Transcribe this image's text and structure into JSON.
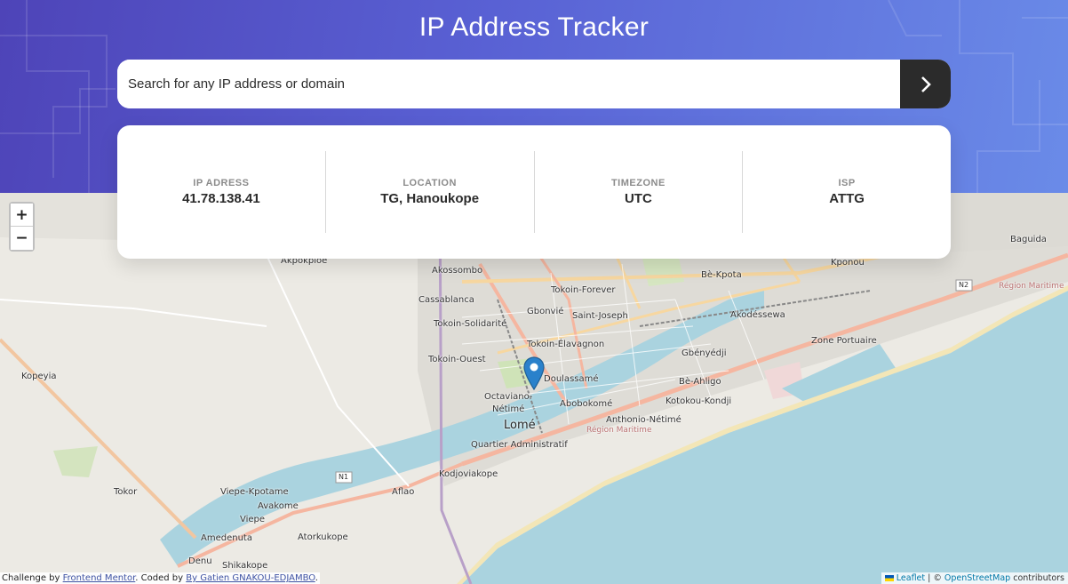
{
  "header": {
    "title": "IP Address Tracker",
    "gradient": [
      "#4e44b8",
      "#6a8be8"
    ]
  },
  "search": {
    "placeholder": "Search for any IP address or domain",
    "button_icon": "chevron-right-icon"
  },
  "info": {
    "ip": {
      "label": "IP ADRESS",
      "value": "41.78.138.41"
    },
    "location": {
      "label": "LOCATION",
      "value": "TG, Hanoukope"
    },
    "timezone": {
      "label": "TIMEZONE",
      "value": "UTC"
    },
    "isp": {
      "label": "ISP",
      "value": "ATTG"
    }
  },
  "map": {
    "zoom_in": "+",
    "zoom_out": "−",
    "marker_color": "#2a81cb",
    "water_color": "#aad3df",
    "labels": {
      "akodessewa": "Akodéssewa",
      "baguida": "Baguida",
      "kponou": "Kponou",
      "akokplo": "Akpokploe",
      "akossombo": "Akossombo",
      "tokoin_forever": "Tokoin-Forever",
      "be_kpota": "Bè-Kpota",
      "cassablanca": "Cassablanca",
      "gbonvie": "Gbonvié",
      "saint_joseph": "Saint-Joseph",
      "tokoin_solidarite": "Tokoin-Solidarité",
      "tokoin_elavagnon": "Tokoin-Élavagnon",
      "zone_portuaire": "Zone Portuaire",
      "tokoin_ouest": "Tokoin-Ouest",
      "gbenyedji": "Gbényédji",
      "kopeyia": "Kopeyia",
      "doulassame": "Doulassamé",
      "be_ahligo": "Bè-Ahligo",
      "octaviano": "Octaviano-",
      "netime": "Nétimé",
      "abobokome": "Abobokomé",
      "kotokou_kondji": "Kotokou-Kondji",
      "anthonio_netime": "Anthonio-Nétimé",
      "lome": "Lomé",
      "quartier_admin": "Quartier Administratif",
      "kodjoviakope": "Kodjoviakope",
      "tokor": "Tokor",
      "viepe_kpotame": "Viepe-Kpotame",
      "aflao": "Aflao",
      "avakome": "Avakome",
      "viepe": "Viepe",
      "amedenuta": "Amedenuta",
      "atorkukope": "Atorkukope",
      "denu": "Denu",
      "shikakope": "Shikakope",
      "region_maritime": "Région Maritime",
      "n1": "N1",
      "n2": "N2"
    }
  },
  "attribution": {
    "leaflet": "Leaflet",
    "sep": " | © ",
    "osm": "OpenStreetMap",
    "contributors": " contributors"
  },
  "credit": {
    "prefix": "Challenge by ",
    "fm": "Frontend Mentor",
    "mid": ". Coded by ",
    "author": "By Gatien GNAKOU-EDJAMBO",
    "suffix": "."
  }
}
